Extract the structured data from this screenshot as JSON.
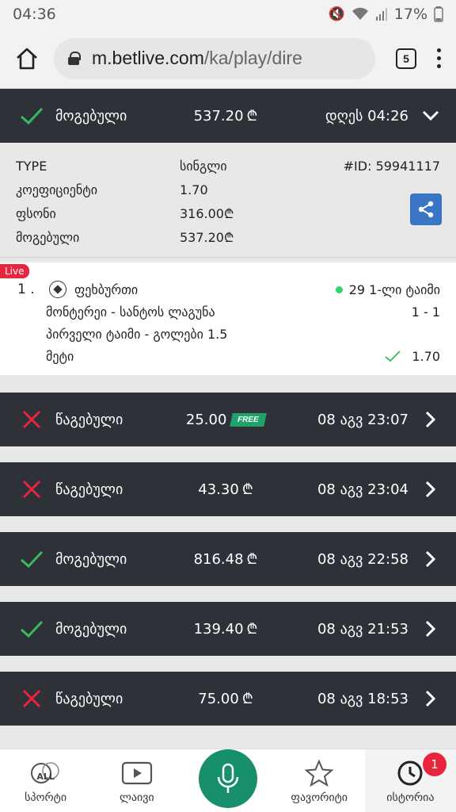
{
  "status_bar": {
    "time": "04:36",
    "battery": "17%"
  },
  "browser": {
    "url_host": "m.betlive.com",
    "url_path": "/ka/play/dire",
    "tab_count": "5"
  },
  "open_bet": {
    "status": "მოგებული",
    "amount": "537.20",
    "date": "დღეს 04:26",
    "won": true,
    "details": {
      "type_label": "TYPE",
      "type_value": "სინგლი",
      "id": "#ID: 59941117",
      "coef_label": "კოეფიციენტი",
      "coef_value": "1.70",
      "stake_label": "ფსონი",
      "stake_value": "316.00",
      "win_label": "მოგებული",
      "win_value": "537.20"
    },
    "event": {
      "live_label": "Live",
      "number": "1 .",
      "sport": "ფეხბურთი",
      "minute": "29 1-ლი ტაიმი",
      "teams": "მონტერეი - სანტოს ლაგუნა",
      "score": "1 - 1",
      "market": "პირველი ტაიმი - გოლები 1.5",
      "selection": "მეტი",
      "odd": "1.70"
    }
  },
  "currency_symbol": "₾",
  "free_label": "FREE",
  "bets": [
    {
      "status": "წაგებული",
      "amount": "25.00",
      "free": true,
      "date": "08 აგვ 23:07",
      "won": false
    },
    {
      "status": "წაგებული",
      "amount": "43.30",
      "free": false,
      "date": "08 აგვ 23:04",
      "won": false
    },
    {
      "status": "მოგებული",
      "amount": "816.48",
      "free": false,
      "date": "08 აგვ 22:58",
      "won": true
    },
    {
      "status": "მოგებული",
      "amount": "139.40",
      "free": false,
      "date": "08 აგვ 21:53",
      "won": true
    },
    {
      "status": "წაგებული",
      "amount": "75.00",
      "free": false,
      "date": "08 აგვ 18:53",
      "won": false
    }
  ],
  "bottom_nav": {
    "sports": "სპორტი",
    "sports_icon_label": "ALL",
    "live": "ლაივი",
    "favorites": "ფავორიტი",
    "history": "ისტორია",
    "history_badge": "1"
  },
  "colors": {
    "win": "#3cb95c",
    "loss": "#e8253d",
    "row_bg": "#2e3137",
    "accent": "#178f6d"
  }
}
